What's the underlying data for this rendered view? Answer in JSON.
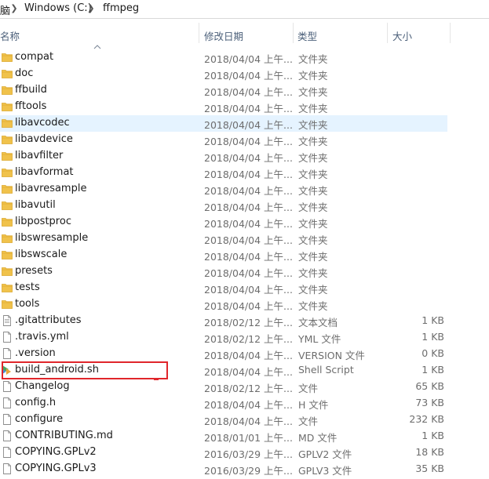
{
  "breadcrumb": {
    "items": [
      "电脑",
      "Windows (C:)",
      "ffmpeg"
    ],
    "separator_icon": "chevron-right-icon"
  },
  "columns": {
    "name": "名称",
    "date": "修改日期",
    "type": "类型",
    "size": "大小",
    "sort_icon": "sort-ascending-icon"
  },
  "colors": {
    "folder": "#f0c24b",
    "folder_tab": "#dca82d",
    "selection": "#e5f3ff",
    "highlight_border": "#e0262b",
    "header_text": "#4c607a"
  },
  "files": [
    {
      "name": "compat",
      "date": "2018/04/04 上午...",
      "type": "文件夹",
      "size": "",
      "icon": "folder-icon"
    },
    {
      "name": "doc",
      "date": "2018/04/04 上午...",
      "type": "文件夹",
      "size": "",
      "icon": "folder-icon"
    },
    {
      "name": "ffbuild",
      "date": "2018/04/04 上午...",
      "type": "文件夹",
      "size": "",
      "icon": "folder-icon"
    },
    {
      "name": "fftools",
      "date": "2018/04/04 上午...",
      "type": "文件夹",
      "size": "",
      "icon": "folder-icon"
    },
    {
      "name": "libavcodec",
      "date": "2018/04/04 上午...",
      "type": "文件夹",
      "size": "",
      "icon": "folder-icon",
      "selected": true
    },
    {
      "name": "libavdevice",
      "date": "2018/04/04 上午...",
      "type": "文件夹",
      "size": "",
      "icon": "folder-icon"
    },
    {
      "name": "libavfilter",
      "date": "2018/04/04 上午...",
      "type": "文件夹",
      "size": "",
      "icon": "folder-icon"
    },
    {
      "name": "libavformat",
      "date": "2018/04/04 上午...",
      "type": "文件夹",
      "size": "",
      "icon": "folder-icon"
    },
    {
      "name": "libavresample",
      "date": "2018/04/04 上午...",
      "type": "文件夹",
      "size": "",
      "icon": "folder-icon"
    },
    {
      "name": "libavutil",
      "date": "2018/04/04 上午...",
      "type": "文件夹",
      "size": "",
      "icon": "folder-icon"
    },
    {
      "name": "libpostproc",
      "date": "2018/04/04 上午...",
      "type": "文件夹",
      "size": "",
      "icon": "folder-icon"
    },
    {
      "name": "libswresample",
      "date": "2018/04/04 上午...",
      "type": "文件夹",
      "size": "",
      "icon": "folder-icon"
    },
    {
      "name": "libswscale",
      "date": "2018/04/04 上午...",
      "type": "文件夹",
      "size": "",
      "icon": "folder-icon"
    },
    {
      "name": "presets",
      "date": "2018/04/04 上午...",
      "type": "文件夹",
      "size": "",
      "icon": "folder-icon"
    },
    {
      "name": "tests",
      "date": "2018/04/04 上午...",
      "type": "文件夹",
      "size": "",
      "icon": "folder-icon"
    },
    {
      "name": "tools",
      "date": "2018/04/04 上午...",
      "type": "文件夹",
      "size": "",
      "icon": "folder-icon"
    },
    {
      "name": ".gitattributes",
      "date": "2018/02/12 上午...",
      "type": "文本文档",
      "size": "1 KB",
      "icon": "text-file-icon"
    },
    {
      "name": ".travis.yml",
      "date": "2018/02/12 上午...",
      "type": "YML 文件",
      "size": "1 KB",
      "icon": "file-icon"
    },
    {
      "name": ".version",
      "date": "2018/04/04 上午...",
      "type": "VERSION 文件",
      "size": "0 KB",
      "icon": "file-icon"
    },
    {
      "name": "build_android.sh",
      "date": "2018/04/04 上午...",
      "type": "Shell Script",
      "size": "1 KB",
      "icon": "shell-script-icon",
      "highlighted": true
    },
    {
      "name": "Changelog",
      "date": "2018/02/12 上午...",
      "type": "文件",
      "size": "65 KB",
      "icon": "file-icon"
    },
    {
      "name": "config.h",
      "date": "2018/04/04 上午...",
      "type": "H 文件",
      "size": "73 KB",
      "icon": "file-icon"
    },
    {
      "name": "configure",
      "date": "2018/04/04 上午...",
      "type": "文件",
      "size": "232 KB",
      "icon": "file-icon"
    },
    {
      "name": "CONTRIBUTING.md",
      "date": "2018/01/01 上午...",
      "type": "MD 文件",
      "size": "1 KB",
      "icon": "file-icon"
    },
    {
      "name": "COPYING.GPLv2",
      "date": "2016/03/29 上午...",
      "type": "GPLV2 文件",
      "size": "18 KB",
      "icon": "file-icon"
    },
    {
      "name": "COPYING.GPLv3",
      "date": "2016/03/29 上午...",
      "type": "GPLV3 文件",
      "size": "35 KB",
      "icon": "file-icon"
    }
  ]
}
